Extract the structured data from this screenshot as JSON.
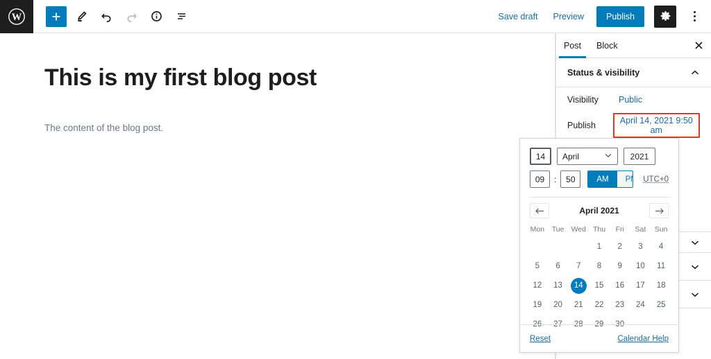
{
  "topbar": {
    "logo_icon": "wordpress-logo-icon",
    "tools": [
      {
        "name": "add-block-button",
        "icon": "plus-icon",
        "primary": true,
        "disabled": false
      },
      {
        "name": "edit-tool-button",
        "icon": "pencil-icon",
        "primary": false,
        "disabled": false
      },
      {
        "name": "undo-button",
        "icon": "undo-icon",
        "primary": false,
        "disabled": false
      },
      {
        "name": "redo-button",
        "icon": "redo-icon",
        "primary": false,
        "disabled": true
      },
      {
        "name": "details-button",
        "icon": "info-icon",
        "primary": false,
        "disabled": false
      },
      {
        "name": "list-view-button",
        "icon": "list-view-icon",
        "primary": false,
        "disabled": false
      }
    ],
    "save_draft_label": "Save draft",
    "preview_label": "Preview",
    "publish_label": "Publish",
    "settings_icon": "gear-icon",
    "more_options_icon": "kebab-menu-icon",
    "accent_color": "#007cba",
    "dark_color": "#1e1e1e"
  },
  "editor": {
    "title": "This is my first blog post",
    "body": "The content of the blog post."
  },
  "sidebar": {
    "tabs": [
      {
        "label": "Post",
        "active": true
      },
      {
        "label": "Block",
        "active": false
      }
    ],
    "close_icon": "close-icon",
    "status_panel": {
      "title": "Status & visibility",
      "chevron_icon": "chevron-up-icon",
      "visibility_label": "Visibility",
      "visibility_value": "Public",
      "publish_label": "Publish",
      "publish_value": "April 14, 2021 9:50 am",
      "annotation_color": "#e32"
    },
    "collapsed_panels": [
      {
        "chevron_icon": "chevron-down-icon"
      },
      {
        "chevron_icon": "chevron-down-icon"
      },
      {
        "chevron_icon": "chevron-down-icon"
      }
    ]
  },
  "datepicker": {
    "day_value": "14",
    "month_value": "April",
    "month_chevron_icon": "chevron-down-icon",
    "year_value": "2021",
    "hour_value": "09",
    "colon": ":",
    "minute_value": "50",
    "am_label": "AM",
    "pm_label": "PM",
    "am_selected": true,
    "timezone_label": "UTC+0",
    "prev_month_icon": "arrow-left-icon",
    "next_month_icon": "arrow-right-icon",
    "calendar_title": "April 2021",
    "weekdays": [
      "Mon",
      "Tue",
      "Wed",
      "Thu",
      "Fri",
      "Sat",
      "Sun"
    ],
    "leading_blanks": 3,
    "days": [
      1,
      2,
      3,
      4,
      5,
      6,
      7,
      8,
      9,
      10,
      11,
      12,
      13,
      14,
      15,
      16,
      17,
      18,
      19,
      20,
      21,
      22,
      23,
      24,
      25,
      26,
      27,
      28,
      29,
      30
    ],
    "selected_day": 14,
    "reset_label": "Reset",
    "calendar_help_label": "Calendar Help"
  }
}
